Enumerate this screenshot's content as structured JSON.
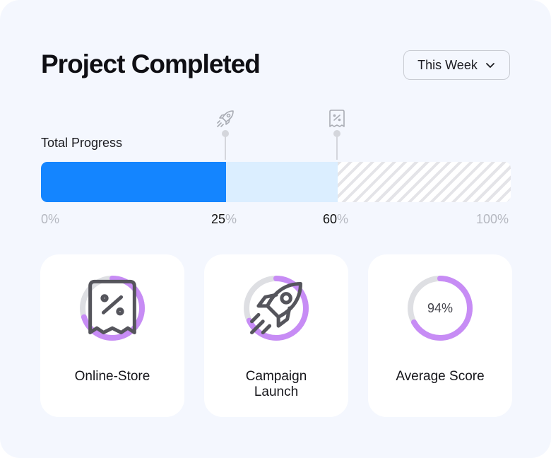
{
  "header": {
    "title": "Project Completed",
    "period_label": "This Week"
  },
  "progress": {
    "label": "Total Progress",
    "completed_pct": 25,
    "in_progress_pct": 60,
    "ticks": [
      {
        "value": "0",
        "unit": "%"
      },
      {
        "value": "25",
        "unit": "%"
      },
      {
        "value": "60",
        "unit": "%"
      },
      {
        "value": "100",
        "unit": "%"
      }
    ],
    "markers": [
      "rocket-icon",
      "receipt-discount-icon"
    ]
  },
  "stats": [
    {
      "label": "Online-Store",
      "icon": "receipt-discount-icon",
      "ring_fraction": 0.7
    },
    {
      "label": "Campaign Launch",
      "icon": "rocket-icon",
      "ring_fraction": 0.68
    },
    {
      "label": "Average Score",
      "value": "94%",
      "ring_fraction": 0.67
    }
  ],
  "colors": {
    "completed": "#1485ff",
    "in_progress": "#dbeeff",
    "ring_active": "#c78cf5",
    "ring_track": "#dedfe3"
  }
}
